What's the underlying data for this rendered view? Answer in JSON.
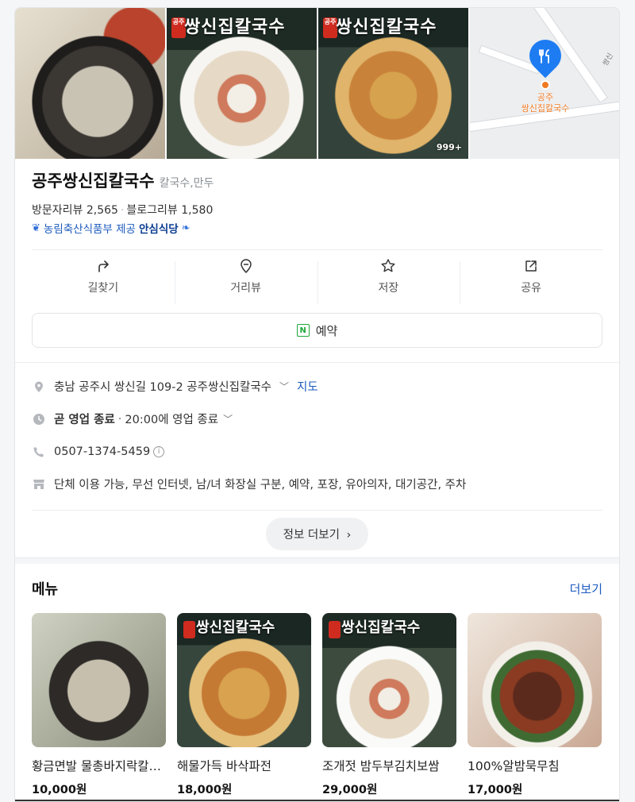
{
  "place": {
    "name": "공주쌍신집칼국수",
    "category": "칼국수,만두",
    "visitor_reviews_label": "방문자리뷰",
    "visitor_reviews_count": "2,565",
    "blog_reviews_label": "블로그리뷰",
    "blog_reviews_count": "1,580",
    "cert_provider": "농림축산식품부 제공",
    "cert_brand": "안심식당"
  },
  "gallery": {
    "brand_text": "쌍신집칼국수",
    "seal_text": "공주",
    "photo_count": "999+",
    "map_pin_label_line1": "공주",
    "map_pin_label_line2": "쌍신집칼국수",
    "map_road_label": "쌍신"
  },
  "actions": [
    {
      "label": "길찾기",
      "icon": "directions-icon"
    },
    {
      "label": "거리뷰",
      "icon": "street-view-icon"
    },
    {
      "label": "저장",
      "icon": "star-icon"
    },
    {
      "label": "공유",
      "icon": "share-icon"
    }
  ],
  "reserve": {
    "label": "예약",
    "icon_text": "N"
  },
  "info": {
    "address": "충남 공주시 쌍신길 109-2 공주쌍신집칼국수",
    "map_link": "지도",
    "status": "곧 영업 종료",
    "hours": "20:00에 영업 종료",
    "phone": "0507-1374-5459",
    "facilities": "단체 이용 가능, 무선 인터넷, 남/녀 화장실 구분, 예약, 포장, 유아의자, 대기공간, 주차",
    "more_label": "정보 더보기"
  },
  "menu": {
    "title": "메뉴",
    "more_label": "더보기",
    "items": [
      {
        "name": "황금면발 물총바지락칼국수",
        "price": "10,000원"
      },
      {
        "name": "해물가득 바삭파전",
        "price": "18,000원"
      },
      {
        "name": "조개젓 밤두부김치보쌈",
        "price": "29,000원"
      },
      {
        "name": "100%알밤묵무침",
        "price": "17,000원"
      }
    ]
  },
  "colors": {
    "accent": "#1c5bbf",
    "pin": "#1d7cf2",
    "pin_dot": "#f07a24",
    "naver_green": "#1ea73a"
  }
}
